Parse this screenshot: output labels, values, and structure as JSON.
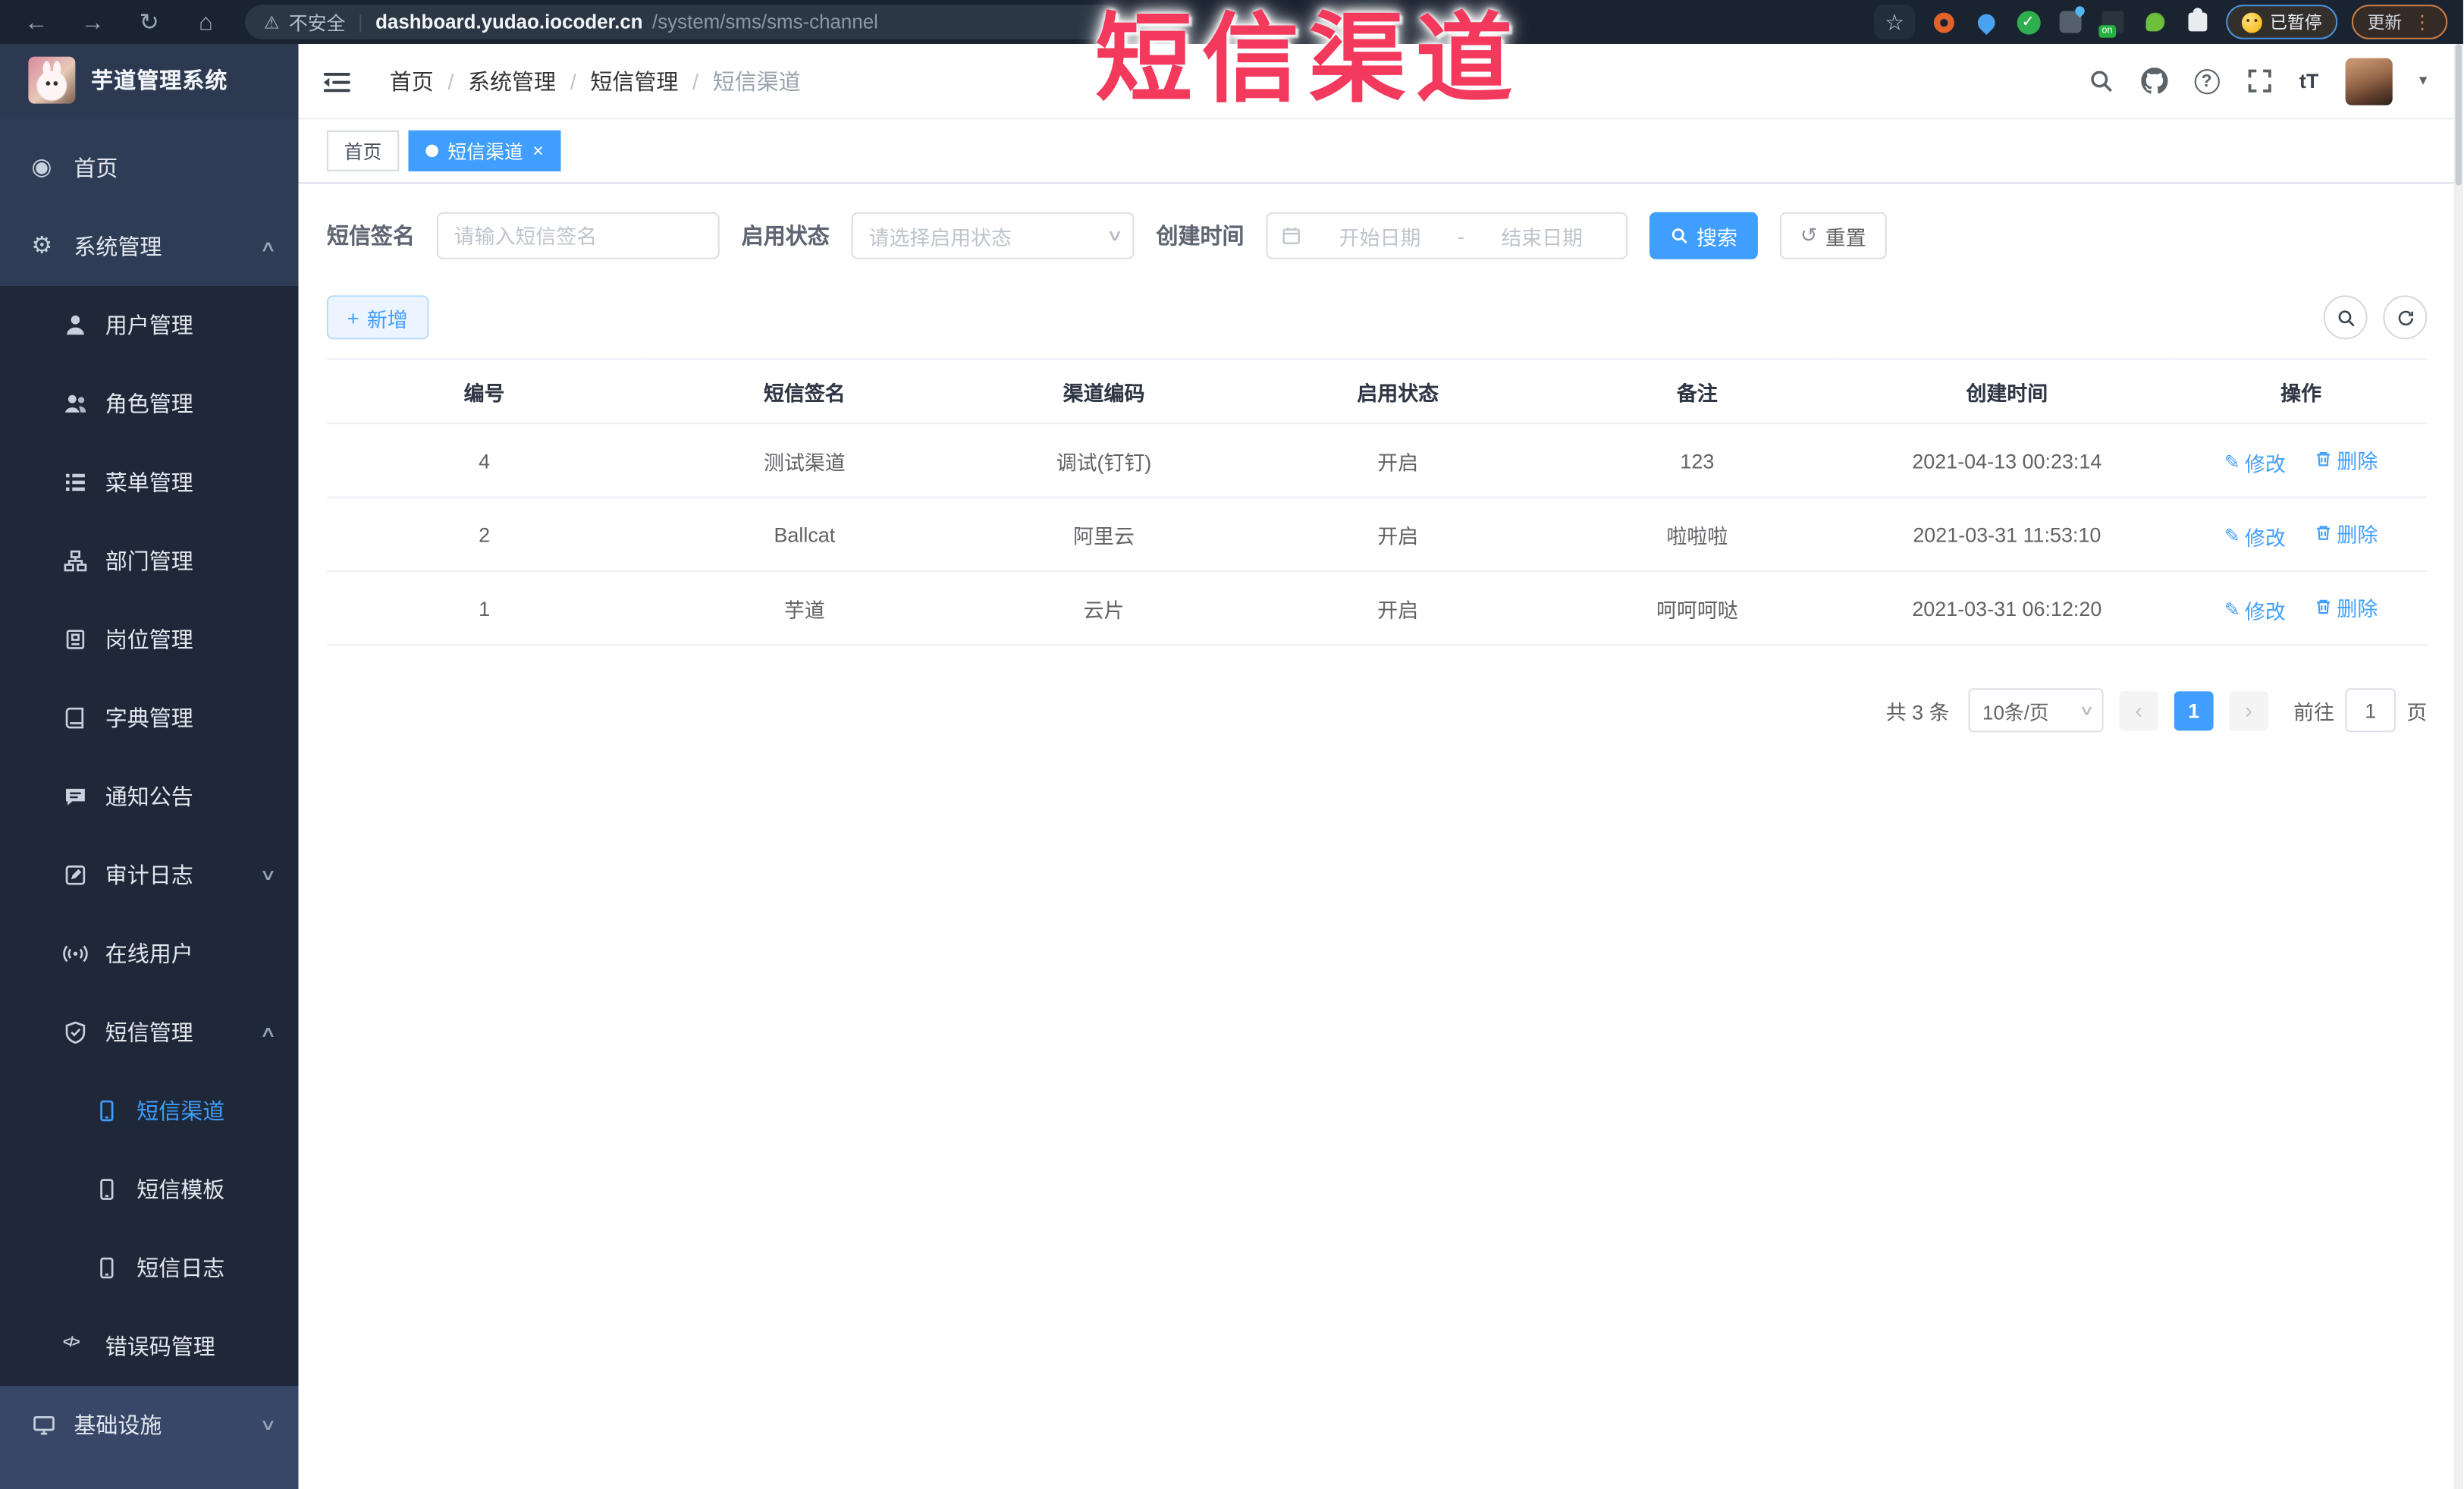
{
  "browser": {
    "security_label": "不安全",
    "url_host": "dashboard.yudao.iocoder.cn",
    "url_path": "/system/sms/sms-channel",
    "extension_badge": "on",
    "paused_label": "已暂停",
    "update_label": "更新"
  },
  "overlay": {
    "title": "短信渠道"
  },
  "sidebar": {
    "app_title": "芋道管理系统",
    "home": "首页",
    "system": "系统管理",
    "user": "用户管理",
    "role": "角色管理",
    "menu": "菜单管理",
    "dept": "部门管理",
    "post": "岗位管理",
    "dict": "字典管理",
    "notice": "通知公告",
    "audit": "审计日志",
    "online": "在线用户",
    "sms": "短信管理",
    "sms_channel": "短信渠道",
    "sms_template": "短信模板",
    "sms_log": "短信日志",
    "errcode": "错误码管理",
    "infra": "基础设施"
  },
  "header": {
    "breadcrumb": [
      "首页",
      "系统管理",
      "短信管理",
      "短信渠道"
    ],
    "breadcrumb_sep": "/"
  },
  "tabs": [
    {
      "label": "首页"
    },
    {
      "label": "短信渠道"
    }
  ],
  "filters": {
    "sign_label": "短信签名",
    "sign_placeholder": "请输入短信签名",
    "status_label": "启用状态",
    "status_placeholder": "请选择启用状态",
    "time_label": "创建时间",
    "start_placeholder": "开始日期",
    "range_separator": "-",
    "end_placeholder": "结束日期",
    "search_label": "搜索",
    "reset_label": "重置"
  },
  "toolbar": {
    "add_label": "新增"
  },
  "table": {
    "headers": [
      "编号",
      "短信签名",
      "渠道编码",
      "启用状态",
      "备注",
      "创建时间",
      "操作"
    ],
    "rows": [
      {
        "id": "4",
        "sign": "测试渠道",
        "code": "调试(钉钉)",
        "status": "开启",
        "remark": "123",
        "created": "2021-04-13 00:23:14"
      },
      {
        "id": "2",
        "sign": "Ballcat",
        "code": "阿里云",
        "status": "开启",
        "remark": "啦啦啦",
        "created": "2021-03-31 11:53:10"
      },
      {
        "id": "1",
        "sign": "芋道",
        "code": "云片",
        "status": "开启",
        "remark": "呵呵呵哒",
        "created": "2021-03-31 06:12:20"
      }
    ],
    "ops": {
      "edit": "修改",
      "delete": "删除"
    }
  },
  "pagination": {
    "total": "共 3 条",
    "page_size": "10条/页",
    "current": "1",
    "goto_label": "前往",
    "goto_value": "1",
    "page_unit": "页"
  },
  "icons": {
    "back": "←",
    "forward": "→",
    "reload": "↻",
    "home": "⌂",
    "warning": "⚠",
    "star": "☆",
    "check": "✓",
    "close": "×",
    "dot_menu": "⋮",
    "divider": "|",
    "chevron_up": "∧",
    "chevron_down": "∨",
    "caret_down": "▾",
    "dashboard": "◉",
    "gear": "⚙",
    "code": "</>",
    "plus": "+",
    "edit": "✎",
    "undo": "↺",
    "question": "?",
    "font_size": "tT",
    "prev": "‹",
    "next": "›"
  },
  "colors": {
    "accent": "#409eff",
    "overlay_red": "#f3395c",
    "sidebar_bg": "#2f3c56",
    "sidebar_submenu_bg": "#1e2838",
    "sidebar_bottom_bg": "#384768",
    "browser_bar_bg": "#1a2330",
    "active_link": "#409eff"
  }
}
